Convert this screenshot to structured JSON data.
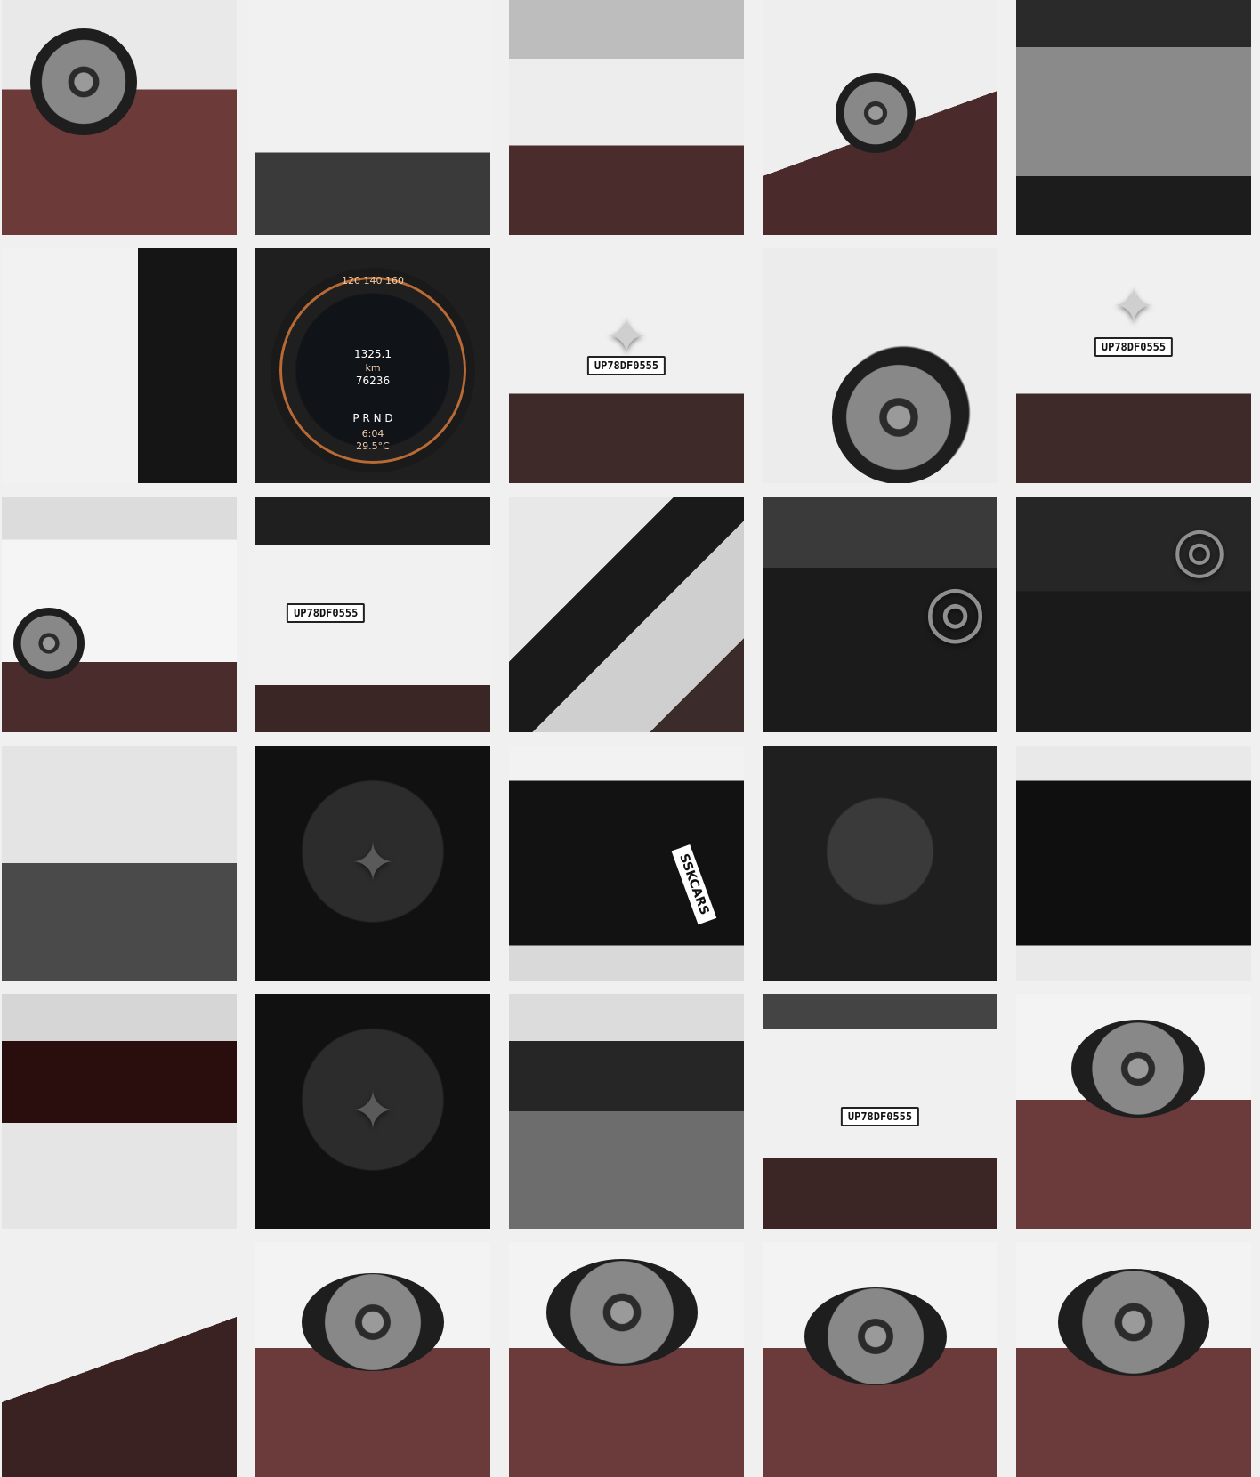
{
  "gallery": {
    "columns": 5,
    "rows": 6,
    "tiles": [
      {
        "label": "",
        "icon": "wheel"
      },
      {
        "label": "",
        "icon": "door"
      },
      {
        "label": "",
        "icon": "car-side"
      },
      {
        "label": "",
        "icon": "headlight"
      },
      {
        "label": "",
        "icon": "engine-bay"
      },
      {
        "label": "",
        "icon": "door-pillar"
      },
      {
        "label": "",
        "icon": "instrument-cluster"
      },
      {
        "label": "UP78DF0555",
        "icon": "front-grille"
      },
      {
        "label": "",
        "icon": "wheel-arch"
      },
      {
        "label": "UP78DF0555",
        "icon": "front-grille"
      },
      {
        "label": "",
        "icon": "car-side"
      },
      {
        "label": "UP78DF0555",
        "icon": "rear-view"
      },
      {
        "label": "",
        "icon": "side-mirror"
      },
      {
        "label": "",
        "icon": "dashboard"
      },
      {
        "label": "",
        "icon": "center-console"
      },
      {
        "label": "",
        "icon": "underbody"
      },
      {
        "label": "",
        "icon": "engine"
      },
      {
        "label": "SSKCARS",
        "icon": "trunk"
      },
      {
        "label": "",
        "icon": "spare-wheel"
      },
      {
        "label": "",
        "icon": "sunroof"
      },
      {
        "label": "",
        "icon": "open-boot"
      },
      {
        "label": "",
        "icon": "engine"
      },
      {
        "label": "",
        "icon": "cabin"
      },
      {
        "label": "UP78DF0555",
        "icon": "rear-view"
      },
      {
        "label": "",
        "icon": "wheel"
      },
      {
        "label": "",
        "icon": "side-mirror"
      },
      {
        "label": "",
        "icon": "wheel"
      },
      {
        "label": "",
        "icon": "wheel"
      },
      {
        "label": "",
        "icon": "wheel"
      },
      {
        "label": "",
        "icon": "wheel"
      }
    ]
  },
  "cluster": {
    "speeds": "120 140 160",
    "trip": "1325.1",
    "unit": "km",
    "odo": "76236",
    "gear": "P R N D",
    "time": "6:04",
    "temp": "29.5°C"
  }
}
